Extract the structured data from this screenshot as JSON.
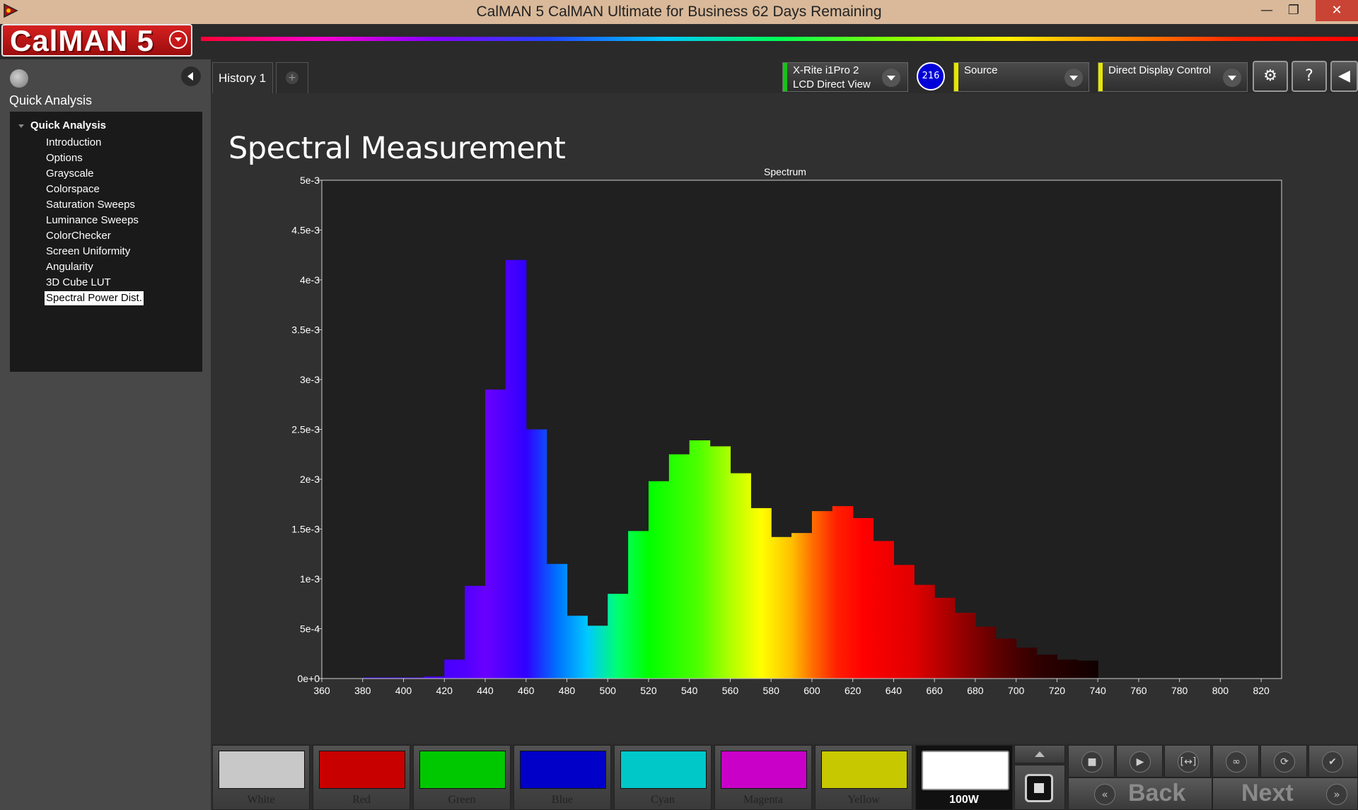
{
  "window": {
    "title": "CalMAN 5 CalMAN Ultimate for Business 62 Days Remaining",
    "min_glyph": "—",
    "max_glyph": "❐",
    "close_glyph": "✕"
  },
  "logo": {
    "text": "CalMAN 5"
  },
  "sidebar": {
    "heading": "Quick Analysis",
    "tree_root": "Quick Analysis",
    "items": [
      {
        "label": "Introduction"
      },
      {
        "label": "Options"
      },
      {
        "label": "Grayscale"
      },
      {
        "label": "Colorspace"
      },
      {
        "label": "Saturation Sweeps"
      },
      {
        "label": "Luminance Sweeps"
      },
      {
        "label": "ColorChecker"
      },
      {
        "label": "Screen Uniformity"
      },
      {
        "label": "Angularity"
      },
      {
        "label": "3D Cube LUT"
      },
      {
        "label": "Spectral Power Dist.",
        "selected": true
      }
    ]
  },
  "tabs": {
    "history": "History 1",
    "add": "+"
  },
  "toolbar": {
    "meter": {
      "line1": "X-Rite i1Pro 2",
      "line2": "LCD Direct View",
      "accent": "#19c219"
    },
    "badge": "216",
    "source": {
      "label": "Source",
      "accent": "#e6e600"
    },
    "display": {
      "label": "Direct Display Control",
      "accent": "#e6e600"
    },
    "settings_icon": "gear-icon",
    "help_icon": "help-icon",
    "help_glyph": "?",
    "settings_glyph": "⚙",
    "collapse_glyph": "◀"
  },
  "page": {
    "title": "Spectral Measurement"
  },
  "chart_data": {
    "type": "bar",
    "title": "Spectrum",
    "xlabel": "",
    "ylabel": "",
    "xlim": [
      360,
      830
    ],
    "ylim": [
      0,
      0.005
    ],
    "grid": false,
    "x_ticks": [
      "360",
      "380",
      "400",
      "420",
      "440",
      "460",
      "480",
      "500",
      "520",
      "540",
      "560",
      "580",
      "600",
      "620",
      "640",
      "660",
      "680",
      "700",
      "720",
      "740",
      "760",
      "780",
      "800",
      "820"
    ],
    "y_ticks": [
      "0e+0",
      "5e-4",
      "1e-3",
      "1.5e-3",
      "2e-3",
      "2.5e-3",
      "3e-3",
      "3.5e-3",
      "4e-3",
      "4.5e-3",
      "5e-3"
    ],
    "bin_width": 10,
    "x": [
      380,
      390,
      400,
      410,
      420,
      430,
      440,
      450,
      460,
      470,
      480,
      490,
      500,
      510,
      520,
      530,
      540,
      550,
      560,
      570,
      580,
      590,
      600,
      610,
      620,
      630,
      640,
      650,
      660,
      670,
      680,
      690,
      700,
      710,
      720,
      730
    ],
    "values": [
      1e-05,
      1e-05,
      1e-05,
      2e-05,
      0.00019,
      0.00093,
      0.0029,
      0.0042,
      0.0025,
      0.00115,
      0.00063,
      0.00053,
      0.00085,
      0.00148,
      0.00198,
      0.00225,
      0.00239,
      0.00233,
      0.00206,
      0.00171,
      0.00142,
      0.00146,
      0.00168,
      0.00173,
      0.00161,
      0.00138,
      0.00114,
      0.00094,
      0.00081,
      0.00066,
      0.00052,
      0.0004,
      0.00031,
      0.00024,
      0.00019,
      0.00018
    ]
  },
  "bottom": {
    "patches": [
      {
        "label": "White",
        "color": "#c8c8c8"
      },
      {
        "label": "Red",
        "color": "#c80000"
      },
      {
        "label": "Green",
        "color": "#00c800"
      },
      {
        "label": "Blue",
        "color": "#0000c8"
      },
      {
        "label": "Cyan",
        "color": "#00c8c8"
      },
      {
        "label": "Magenta",
        "color": "#c800c8"
      },
      {
        "label": "Yellow",
        "color": "#c8c800"
      },
      {
        "label": "100W",
        "color": "#ffffff"
      }
    ],
    "controls": [
      {
        "glyph": "■"
      },
      {
        "glyph": "▶"
      },
      {
        "glyph": "[↔]"
      },
      {
        "glyph": "∞"
      },
      {
        "glyph": "⟳"
      },
      {
        "glyph": "✔"
      }
    ],
    "back": {
      "label": "Back",
      "glyph": "«"
    },
    "next": {
      "label": "Next",
      "glyph": "»"
    }
  }
}
